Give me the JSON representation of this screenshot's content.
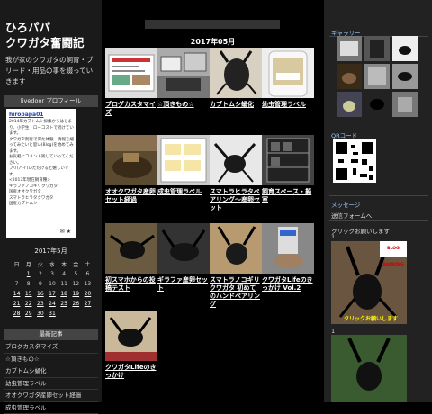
{
  "blog": {
    "title_line1": "ひろパパ",
    "title_line2": "クワガタ奮闘記",
    "description": "我が家のクワガタの飼育・ブリード・用品の事を綴っていきます"
  },
  "profile": {
    "heading": "livedoor プロフィール",
    "name": "hiropapa01",
    "text": "2014年カブトムシ採集からはじまり、小学生・ローコストで続けています。\nクワガタ飼育で得た体験・情報を綴ってみたいと思い(Blog)を始めてみます。\nお気軽にコメント残していってください。\nブリ(ハイ)いただけると嬉しいです。\n<2017年現在飼育種>\nギラファノコギリクワガタ\n国産オオクワガタ\nスマトラヒラタクワガタ\n国産カブトムシ",
    "icons": "✉ ★"
  },
  "calendar": {
    "title": "2017年5月",
    "weekdays": [
      "日",
      "月",
      "火",
      "水",
      "木",
      "金",
      "土"
    ],
    "weeks": [
      [
        "",
        "1",
        "2",
        "3",
        "4",
        "5",
        "6"
      ],
      [
        "7",
        "8",
        "9",
        "10",
        "11",
        "12",
        "13"
      ],
      [
        "14",
        "15",
        "16",
        "17",
        "18",
        "19",
        "20"
      ],
      [
        "21",
        "22",
        "23",
        "24",
        "25",
        "26",
        "27"
      ],
      [
        "28",
        "29",
        "30",
        "31",
        "",
        "",
        ""
      ]
    ]
  },
  "recent": {
    "heading": "最新記事",
    "items": [
      "ブログカスタマイズ",
      "☆頂きもの☆",
      "カブトムシ蛹化",
      "幼虫管理ラベル",
      "オオクワガタ産卵セット経過",
      "成虫管理ラベル"
    ]
  },
  "main": {
    "month_heading": "2017年05月",
    "tiles": [
      {
        "label": "ブログカスタマイズ"
      },
      {
        "label": "☆頂きもの☆"
      },
      {
        "label": "カブトムシ蛹化"
      },
      {
        "label": "幼虫管理ラベル"
      },
      {
        "label": "オオクワガタ産卵セット経過"
      },
      {
        "label": "成虫管理ラベル"
      },
      {
        "label": "スマトラヒラタペアリング～産卵セット"
      },
      {
        "label": "飼育スペース・擬室"
      },
      {
        "label": "初スマホからの投稿テスト"
      },
      {
        "label": "ギラファ産卵セット"
      },
      {
        "label": "スマトラノコギリクワガタ 初めてのハンドペアリング"
      },
      {
        "label": "クワガタLifeのきっかけ Vol.2"
      },
      {
        "label": "クワガタLifeのきっかけ"
      }
    ]
  },
  "sidebar_right": {
    "gallery_heading": "ギャラリー",
    "qr_heading": "QRコード",
    "message_heading": "メッセージ",
    "message_link": "送信フォームへ",
    "rank_text_1": "クリックお願いします！",
    "rank_text_1b": "1",
    "rank_badge": "BLOG RANKING",
    "rank_overlay": "クリックお願いします",
    "rank_text_2b": "1"
  },
  "colors": {
    "accent": "#99ccff",
    "link": "#2244aa",
    "header_bg": "#444444"
  }
}
